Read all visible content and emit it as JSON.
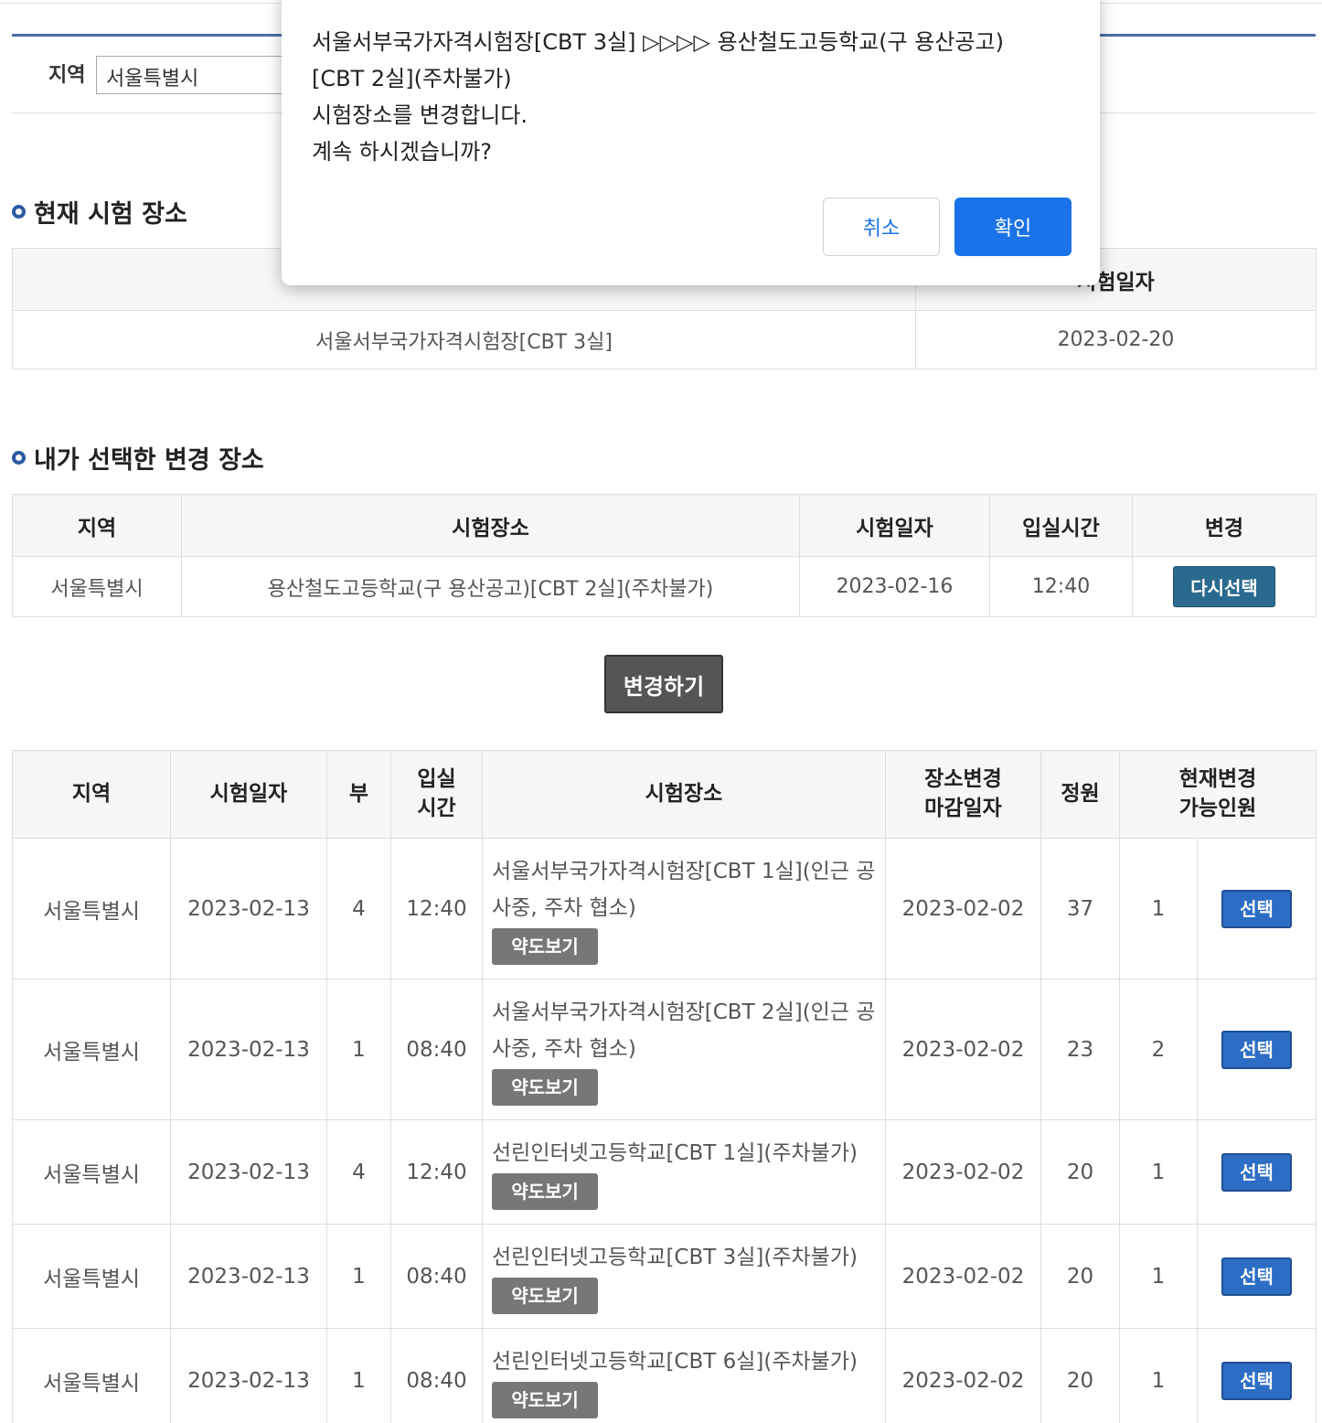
{
  "filter": {
    "region_label": "지역",
    "region_value": "서울특별시"
  },
  "current_section": {
    "title": "현재 시험 장소",
    "header_date": "시험일자",
    "place": "서울서부국가자격시험장[CBT 3실]",
    "date": "2023-02-20"
  },
  "selected_section": {
    "title": "내가 선택한 변경 장소",
    "headers": [
      "지역",
      "시험장소",
      "시험일자",
      "입실시간",
      "변경"
    ],
    "row": {
      "region": "서울특별시",
      "place": "용산철도고등학교(구 용산공고)[CBT 2실](주차불가)",
      "date": "2023-02-16",
      "time": "12:40",
      "button": "다시선택"
    }
  },
  "change_button": "변경하기",
  "list": {
    "headers": {
      "region": "지역",
      "date": "시험일자",
      "part": "부",
      "time_line1": "입실",
      "time_line2": "시간",
      "place": "시험장소",
      "deadline_line1": "장소변경",
      "deadline_line2": "마감일자",
      "capacity": "정원",
      "avail_line1": "현재변경",
      "avail_line2": "가능인원"
    },
    "map_button": "약도보기",
    "select_button": "선택",
    "rows": [
      {
        "region": "서울특별시",
        "date": "2023-02-13",
        "part": "4",
        "time": "12:40",
        "place": "서울서부국가자격시험장[CBT 1실](인근 공사중, 주차 협소)",
        "deadline": "2023-02-02",
        "capacity": "37",
        "available": "1"
      },
      {
        "region": "서울특별시",
        "date": "2023-02-13",
        "part": "1",
        "time": "08:40",
        "place": "서울서부국가자격시험장[CBT 2실](인근 공사중, 주차 협소)",
        "deadline": "2023-02-02",
        "capacity": "23",
        "available": "2"
      },
      {
        "region": "서울특별시",
        "date": "2023-02-13",
        "part": "4",
        "time": "12:40",
        "place": "선린인터넷고등학교[CBT 1실](주차불가)",
        "deadline": "2023-02-02",
        "capacity": "20",
        "available": "1"
      },
      {
        "region": "서울특별시",
        "date": "2023-02-13",
        "part": "1",
        "time": "08:40",
        "place": "선린인터넷고등학교[CBT 3실](주차불가)",
        "deadline": "2023-02-02",
        "capacity": "20",
        "available": "1"
      },
      {
        "region": "서울특별시",
        "date": "2023-02-13",
        "part": "1",
        "time": "08:40",
        "place": "선린인터넷고등학교[CBT 6실](주차불가)",
        "deadline": "2023-02-02",
        "capacity": "20",
        "available": "1"
      }
    ]
  },
  "dialog": {
    "line1": "서울서부국가자격시험장[CBT 3실] ▷▷▷▷ 용산철도고등학교(구 용산공고)",
    "line2": "[CBT 2실](주차불가)",
    "line3": "시험장소를 변경합니다.",
    "line4": "계속 하시겠습니까?",
    "cancel": "취소",
    "ok": "확인"
  }
}
